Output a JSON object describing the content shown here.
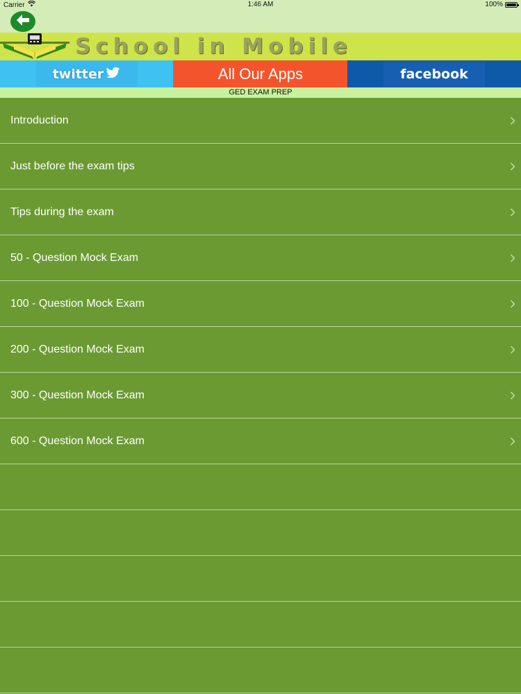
{
  "status_bar": {
    "carrier": "Carrier",
    "time": "1:46 AM",
    "battery": "100%",
    "wifi_icon": "wifi-icon",
    "battery_icon": "battery-icon"
  },
  "nav": {
    "back_icon": "arrow-left-icon"
  },
  "banner": {
    "title": "School in Mobile",
    "colors": {
      "background": "#cfe34a",
      "text": "#9aa45a"
    }
  },
  "social": {
    "twitter_label": "twitter",
    "apps_label": "All Our Apps",
    "facebook_label": "facebook",
    "colors": {
      "twitter": "#3fc1f2",
      "apps": "#f4542c",
      "facebook": "#0f5aa8"
    }
  },
  "subtitle": "GED EXAM PREP",
  "menu": {
    "items": [
      {
        "label": "Introduction"
      },
      {
        "label": "Just before the exam tips"
      },
      {
        "label": "Tips during the exam"
      },
      {
        "label": "50 - Question Mock Exam"
      },
      {
        "label": "100 - Question Mock Exam"
      },
      {
        "label": "200 - Question Mock Exam"
      },
      {
        "label": "300 - Question Mock Exam"
      },
      {
        "label": "600 - Question Mock Exam"
      }
    ],
    "chevron_icon": "chevron-right-icon",
    "colors": {
      "background": "#6b9a33",
      "separator": "#b9d59c",
      "text": "#ffffff"
    }
  }
}
